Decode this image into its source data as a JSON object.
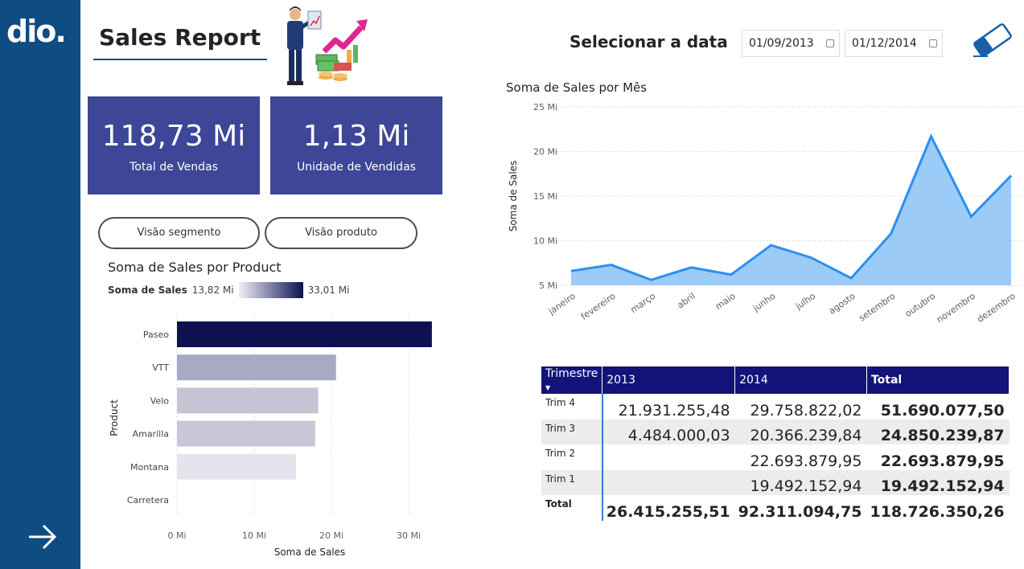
{
  "sidebar": {
    "logo_text": "dio.",
    "next_icon": "arrow-right-icon"
  },
  "header": {
    "title": "Sales Report"
  },
  "cards": [
    {
      "value": "118,73 Mi",
      "label": "Total de Vendas"
    },
    {
      "value": "1,13 Mi",
      "label": "Unidade de Vendidas"
    }
  ],
  "buttons": {
    "segment": "Visão segmento",
    "product": "Visão produto"
  },
  "date_filter": {
    "label": "Selecionar a data",
    "start": "01/09/2013",
    "end": "01/12/2014"
  },
  "colors": {
    "sidebar": "#0f4c81",
    "card": "#3d4697",
    "table_header": "#13137a",
    "area_fill": "#9ccbf7",
    "area_line": "#2b8ff0",
    "bar_max": "#0d1150"
  },
  "chart_data": [
    {
      "type": "bar",
      "title": "Soma de Sales por Product",
      "legend_label": "Soma de  Sales",
      "legend_min": "13,82 Mi",
      "legend_max": "33,01 Mi",
      "categories": [
        "Paseo",
        "VTT",
        "Velo",
        "Amarilla",
        "Montana",
        "Carretera"
      ],
      "values": [
        33.01,
        20.6,
        18.3,
        17.9,
        15.4,
        0
      ],
      "bar_colors": [
        "#0d1150",
        "#a9a9c4",
        "#c5c5d6",
        "#c7c7d7",
        "#e4e4ec",
        "#ffffff"
      ],
      "xlabel": "Soma de Sales",
      "ylabel": "Product",
      "xticks": [
        "0 Mi",
        "10 Mi",
        "20 Mi",
        "30 Mi"
      ],
      "xlim": [
        0,
        35
      ]
    },
    {
      "type": "area",
      "title": "Soma de Sales por Mês",
      "ylabel": "Soma de Sales",
      "categories": [
        "janeiro",
        "fevereiro",
        "março",
        "abril",
        "maio",
        "junho",
        "julho",
        "agosto",
        "setembro",
        "outubro",
        "novembro",
        "dezembro"
      ],
      "values": [
        6.6,
        7.3,
        5.6,
        7.0,
        6.2,
        9.5,
        8.1,
        5.8,
        10.8,
        21.7,
        12.7,
        17.3
      ],
      "yticks": [
        "5 Mi",
        "10 Mi",
        "15 Mi",
        "20 Mi",
        "25 Mi"
      ],
      "ylim": [
        5,
        25
      ]
    }
  ],
  "matrix": {
    "headers": [
      "Trimestre",
      "2013",
      "2014",
      "Total"
    ],
    "rows": [
      {
        "label": "Trim 4",
        "y2013": "21.931.255,48",
        "y2014": "29.758.822,02",
        "total": "51.690.077,50"
      },
      {
        "label": "Trim 3",
        "y2013": "4.484.000,03",
        "y2014": "20.366.239,84",
        "total": "24.850.239,87"
      },
      {
        "label": "Trim 2",
        "y2013": "",
        "y2014": "22.693.879,95",
        "total": "22.693.879,95"
      },
      {
        "label": "Trim 1",
        "y2013": "",
        "y2014": "19.492.152,94",
        "total": "19.492.152,94"
      }
    ],
    "total_row": {
      "label": "Total",
      "y2013": "26.415.255,51",
      "y2014": "92.311.094,75",
      "total": "118.726.350,26"
    }
  }
}
